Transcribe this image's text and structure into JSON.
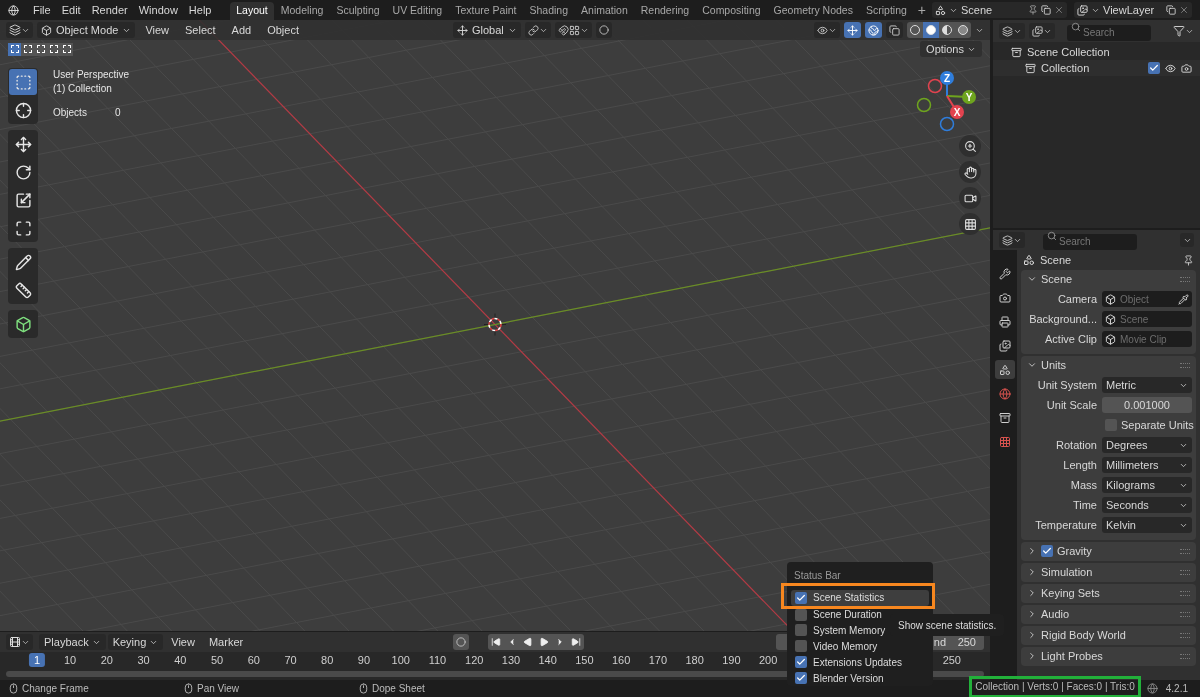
{
  "menu": [
    "File",
    "Edit",
    "Render",
    "Window",
    "Help"
  ],
  "workspaces": [
    {
      "label": "Layout",
      "selected": true
    },
    {
      "label": "Modeling",
      "selected": false
    },
    {
      "label": "Sculpting",
      "selected": false
    },
    {
      "label": "UV Editing",
      "selected": false
    },
    {
      "label": "Texture Paint",
      "selected": false
    },
    {
      "label": "Shading",
      "selected": false
    },
    {
      "label": "Animation",
      "selected": false
    },
    {
      "label": "Rendering",
      "selected": false
    },
    {
      "label": "Compositing",
      "selected": false
    },
    {
      "label": "Geometry Nodes",
      "selected": false
    },
    {
      "label": "Scripting",
      "selected": false
    }
  ],
  "add_workspace": "+",
  "scene": "Scene",
  "view_layer": "ViewLayer",
  "viewport": {
    "mode": "Object Mode",
    "menus": [
      "View",
      "Select",
      "Add",
      "Object"
    ],
    "orientation": "Global",
    "gizmos_on": true,
    "overlays_on": true,
    "shading": [
      {
        "kind": "wireframe",
        "selected": false
      },
      {
        "kind": "solid",
        "selected": true
      },
      {
        "kind": "material",
        "selected": false
      },
      {
        "kind": "rendered",
        "selected": false
      }
    ],
    "select_modes": [
      {
        "selected": true
      },
      {
        "selected": false
      },
      {
        "selected": false
      },
      {
        "selected": false
      },
      {
        "selected": false
      }
    ],
    "options": "Options",
    "info": [
      "User Perspective",
      "(1) Collection"
    ],
    "stats": {
      "label": "Objects",
      "value": "0"
    },
    "tools": [
      {
        "kind": "select",
        "selected": true
      },
      {
        "kind": "cursor",
        "selected": false
      },
      {
        "kind": "move",
        "selected": false
      },
      {
        "kind": "rotate",
        "selected": false
      },
      {
        "kind": "scale",
        "selected": false
      },
      {
        "kind": "transform",
        "selected": false
      },
      {
        "kind": "annotate",
        "selected": false
      },
      {
        "kind": "measure",
        "selected": false
      },
      {
        "kind": "add",
        "selected": false
      }
    ],
    "axes": [
      {
        "label": "Z",
        "color": "#2f7ddb"
      },
      {
        "label": "Y",
        "color": "#6ea41e"
      },
      {
        "label": "X",
        "color": "#e2434f"
      }
    ]
  },
  "outliner": {
    "placeholder": "Search",
    "items": [
      {
        "label": "Scene Collection",
        "children": [
          {
            "label": "Collection",
            "checked": true
          }
        ]
      }
    ]
  },
  "properties": {
    "placeholder": "Search",
    "context": "Scene",
    "tabs": [
      {
        "kind": "tool",
        "selected": false
      },
      {
        "kind": "render",
        "selected": false
      },
      {
        "kind": "output",
        "selected": false
      },
      {
        "kind": "view_layer",
        "selected": false
      },
      {
        "kind": "scene",
        "selected": true
      },
      {
        "kind": "world",
        "selected": false
      },
      {
        "kind": "collection",
        "selected": false
      },
      {
        "kind": "texture",
        "selected": false
      }
    ],
    "panels": [
      {
        "title": "Scene",
        "expanded": true,
        "rows": [
          {
            "kind": "picker",
            "label": "Camera",
            "placeholder": "Object"
          },
          {
            "kind": "picker",
            "label": "Background...",
            "placeholder": "Scene"
          },
          {
            "kind": "picker",
            "label": "Active Clip",
            "placeholder": "Movie Clip"
          }
        ]
      },
      {
        "title": "Units",
        "expanded": true,
        "rows": [
          {
            "kind": "dropdown",
            "label": "Unit System",
            "value": "Metric"
          },
          {
            "kind": "number",
            "label": "Unit Scale",
            "value": "0.001000"
          },
          {
            "kind": "checkbox",
            "label": "Separate Units",
            "checked": false
          },
          {
            "kind": "dropdown",
            "label": "Rotation",
            "value": "Degrees"
          },
          {
            "kind": "dropdown",
            "label": "Length",
            "value": "Millimeters"
          },
          {
            "kind": "dropdown",
            "label": "Mass",
            "value": "Kilograms"
          },
          {
            "kind": "dropdown",
            "label": "Time",
            "value": "Seconds"
          },
          {
            "kind": "dropdown",
            "label": "Temperature",
            "value": "Kelvin"
          }
        ]
      },
      {
        "title": "Gravity",
        "expanded": false,
        "checked": true
      },
      {
        "title": "Simulation",
        "expanded": false
      },
      {
        "title": "Keying Sets",
        "expanded": false
      },
      {
        "title": "Audio",
        "expanded": false
      },
      {
        "title": "Rigid Body World",
        "expanded": false
      },
      {
        "title": "Light Probes",
        "expanded": false
      }
    ]
  },
  "timeline": {
    "menus": [
      "Playback",
      "Keying",
      "View",
      "Marker"
    ],
    "end_label": "nd",
    "end_value": "250",
    "frames": [
      {
        "label": "1",
        "selected": true
      },
      {
        "label": "10",
        "selected": false
      },
      {
        "label": "20",
        "selected": false
      },
      {
        "label": "30",
        "selected": false
      },
      {
        "label": "40",
        "selected": false
      },
      {
        "label": "50",
        "selected": false
      },
      {
        "label": "60",
        "selected": false
      },
      {
        "label": "70",
        "selected": false
      },
      {
        "label": "80",
        "selected": false
      },
      {
        "label": "90",
        "selected": false
      },
      {
        "label": "100",
        "selected": false
      },
      {
        "label": "110",
        "selected": false
      },
      {
        "label": "120",
        "selected": false
      },
      {
        "label": "130",
        "selected": false
      },
      {
        "label": "140",
        "selected": false
      },
      {
        "label": "150",
        "selected": false
      },
      {
        "label": "160",
        "selected": false
      },
      {
        "label": "170",
        "selected": false
      },
      {
        "label": "180",
        "selected": false
      },
      {
        "label": "190",
        "selected": false
      },
      {
        "label": "200",
        "selected": false
      },
      {
        "label": "250",
        "selected": false
      }
    ]
  },
  "status_bar": {
    "hints": [
      "Change Frame",
      "Pan View",
      "Dope Sheet"
    ],
    "stats": "Collection | Verts:0 | Faces:0 | Tris:0",
    "version": "4.2.1"
  },
  "status_menu": {
    "title": "Status Bar",
    "items": [
      {
        "label": "Scene Statistics",
        "checked": true,
        "selected": true
      },
      {
        "label": "Scene Duration",
        "checked": false,
        "selected": false
      },
      {
        "label": "System Memory",
        "checked": false,
        "selected": false
      },
      {
        "label": "Video Memory",
        "checked": false,
        "selected": false
      },
      {
        "label": "Extensions Updates",
        "checked": true,
        "selected": false
      },
      {
        "label": "Blender Version",
        "checked": true,
        "selected": false
      }
    ]
  },
  "tooltip": "Show scene statistics."
}
